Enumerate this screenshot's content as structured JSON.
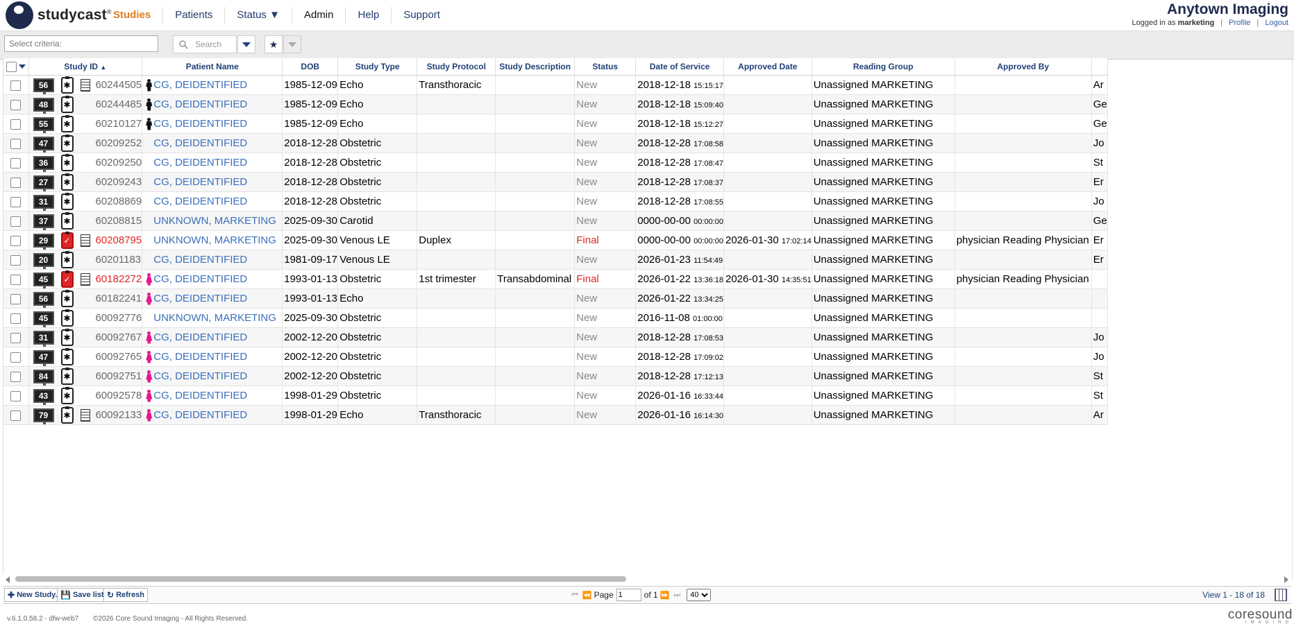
{
  "logo": {
    "wordmark": "studycast",
    "tm": "®"
  },
  "nav": [
    {
      "label": "Studies",
      "active": true
    },
    {
      "label": "Patients"
    },
    {
      "label": "Status ▼"
    },
    {
      "label": "Admin"
    },
    {
      "label": "Help"
    },
    {
      "label": "Support"
    }
  ],
  "brand": {
    "title": "Anytown Imaging",
    "logged_prefix": "Logged in as",
    "user": "marketing",
    "profile": "Profile",
    "logout": "Logout"
  },
  "toolbar": {
    "criteria_placeholder": "Select criteria:",
    "search_label": "Search"
  },
  "columns": [
    "Study ID",
    "Patient Name",
    "DOB",
    "Study Type",
    "Study Protocol",
    "Study Description",
    "Status",
    "Date of Service",
    "Approved Date",
    "Reading Group",
    "Approved By"
  ],
  "rows": [
    {
      "count": "56",
      "final": false,
      "doc": true,
      "id": "60244505",
      "gender": "m",
      "patient": "CG, DEIDENTIFIED",
      "dob": "1985-12-09",
      "type": "Echo",
      "protocol": "Transthoracic",
      "desc": "",
      "status": "New",
      "dos": "2018-12-18",
      "dos_t": "15:15:17",
      "appr": "",
      "appr_t": "",
      "group": "Unassigned MARKETING",
      "by": "",
      "extra": "Ar"
    },
    {
      "count": "48",
      "final": false,
      "doc": false,
      "id": "60244485",
      "gender": "m",
      "patient": "CG, DEIDENTIFIED",
      "dob": "1985-12-09",
      "type": "Echo",
      "protocol": "",
      "desc": "",
      "status": "New",
      "dos": "2018-12-18",
      "dos_t": "15:09:40",
      "appr": "",
      "appr_t": "",
      "group": "Unassigned MARKETING",
      "by": "",
      "extra": "Ge"
    },
    {
      "count": "55",
      "final": false,
      "doc": false,
      "id": "60210127",
      "gender": "m",
      "patient": "CG, DEIDENTIFIED",
      "dob": "1985-12-09",
      "type": "Echo",
      "protocol": "",
      "desc": "",
      "status": "New",
      "dos": "2018-12-18",
      "dos_t": "15:12:27",
      "appr": "",
      "appr_t": "",
      "group": "Unassigned MARKETING",
      "by": "",
      "extra": "Ge"
    },
    {
      "count": "47",
      "final": false,
      "doc": false,
      "id": "60209252",
      "gender": "n",
      "patient": "CG, DEIDENTIFIED",
      "dob": "2018-12-28",
      "type": "Obstetric",
      "protocol": "",
      "desc": "",
      "status": "New",
      "dos": "2018-12-28",
      "dos_t": "17:08:58",
      "appr": "",
      "appr_t": "",
      "group": "Unassigned MARKETING",
      "by": "",
      "extra": "Jo"
    },
    {
      "count": "36",
      "final": false,
      "doc": false,
      "id": "60209250",
      "gender": "n",
      "patient": "CG, DEIDENTIFIED",
      "dob": "2018-12-28",
      "type": "Obstetric",
      "protocol": "",
      "desc": "",
      "status": "New",
      "dos": "2018-12-28",
      "dos_t": "17:08:47",
      "appr": "",
      "appr_t": "",
      "group": "Unassigned MARKETING",
      "by": "",
      "extra": "St"
    },
    {
      "count": "27",
      "final": false,
      "doc": false,
      "id": "60209243",
      "gender": "n",
      "patient": "CG, DEIDENTIFIED",
      "dob": "2018-12-28",
      "type": "Obstetric",
      "protocol": "",
      "desc": "",
      "status": "New",
      "dos": "2018-12-28",
      "dos_t": "17:08:37",
      "appr": "",
      "appr_t": "",
      "group": "Unassigned MARKETING",
      "by": "",
      "extra": "Er"
    },
    {
      "count": "31",
      "final": false,
      "doc": false,
      "id": "60208869",
      "gender": "n",
      "patient": "CG, DEIDENTIFIED",
      "dob": "2018-12-28",
      "type": "Obstetric",
      "protocol": "",
      "desc": "",
      "status": "New",
      "dos": "2018-12-28",
      "dos_t": "17:08:55",
      "appr": "",
      "appr_t": "",
      "group": "Unassigned MARKETING",
      "by": "",
      "extra": "Jo"
    },
    {
      "count": "37",
      "final": false,
      "doc": false,
      "id": "60208815",
      "gender": "n",
      "patient": "UNKNOWN, MARKETING",
      "dob": "2025-09-30",
      "type": "Carotid",
      "protocol": "",
      "desc": "",
      "status": "New",
      "dos": "0000-00-00",
      "dos_t": "00:00:00",
      "appr": "",
      "appr_t": "",
      "group": "Unassigned MARKETING",
      "by": "",
      "extra": "Ge"
    },
    {
      "count": "29",
      "final": true,
      "doc": true,
      "id": "60208795",
      "gender": "n",
      "patient": "UNKNOWN, MARKETING",
      "dob": "2025-09-30",
      "type": "Venous LE",
      "protocol": "Duplex",
      "desc": "",
      "status": "Final",
      "dos": "0000-00-00",
      "dos_t": "00:00:00",
      "appr": "2026-01-30",
      "appr_t": "17:02:14",
      "group": "Unassigned MARKETING",
      "by": "physician Reading Physician",
      "extra": "Er"
    },
    {
      "count": "20",
      "final": false,
      "doc": false,
      "id": "60201183",
      "gender": "n",
      "patient": "CG, DEIDENTIFIED",
      "dob": "1981-09-17",
      "type": "Venous LE",
      "protocol": "",
      "desc": "",
      "status": "New",
      "dos": "2026-01-23",
      "dos_t": "11:54:49",
      "appr": "",
      "appr_t": "",
      "group": "Unassigned MARKETING",
      "by": "",
      "extra": "Er"
    },
    {
      "count": "45",
      "final": true,
      "doc": true,
      "id": "60182272",
      "gender": "f",
      "patient": "CG, DEIDENTIFIED",
      "dob": "1993-01-13",
      "type": "Obstetric",
      "protocol": "1st trimester",
      "desc": "Transabdominal",
      "status": "Final",
      "dos": "2026-01-22",
      "dos_t": "13:36:18",
      "appr": "2026-01-30",
      "appr_t": "14:35:51",
      "group": "Unassigned MARKETING",
      "by": "physician Reading Physician",
      "extra": ""
    },
    {
      "count": "56",
      "final": false,
      "doc": false,
      "id": "60182241",
      "gender": "f",
      "patient": "CG, DEIDENTIFIED",
      "dob": "1993-01-13",
      "type": "Echo",
      "protocol": "",
      "desc": "",
      "status": "New",
      "dos": "2026-01-22",
      "dos_t": "13:34:25",
      "appr": "",
      "appr_t": "",
      "group": "Unassigned MARKETING",
      "by": "",
      "extra": ""
    },
    {
      "count": "45",
      "final": false,
      "doc": false,
      "id": "60092776",
      "gender": "n",
      "patient": "UNKNOWN, MARKETING",
      "dob": "2025-09-30",
      "type": "Obstetric",
      "protocol": "",
      "desc": "",
      "status": "New",
      "dos": "2016-11-08",
      "dos_t": "01:00:00",
      "appr": "",
      "appr_t": "",
      "group": "Unassigned MARKETING",
      "by": "",
      "extra": ""
    },
    {
      "count": "31",
      "final": false,
      "doc": false,
      "id": "60092767",
      "gender": "f",
      "patient": "CG, DEIDENTIFIED",
      "dob": "2002-12-20",
      "type": "Obstetric",
      "protocol": "",
      "desc": "",
      "status": "New",
      "dos": "2018-12-28",
      "dos_t": "17:08:53",
      "appr": "",
      "appr_t": "",
      "group": "Unassigned MARKETING",
      "by": "",
      "extra": "Jo"
    },
    {
      "count": "47",
      "final": false,
      "doc": false,
      "id": "60092765",
      "gender": "f",
      "patient": "CG, DEIDENTIFIED",
      "dob": "2002-12-20",
      "type": "Obstetric",
      "protocol": "",
      "desc": "",
      "status": "New",
      "dos": "2018-12-28",
      "dos_t": "17:09:02",
      "appr": "",
      "appr_t": "",
      "group": "Unassigned MARKETING",
      "by": "",
      "extra": "Jo"
    },
    {
      "count": "84",
      "final": false,
      "doc": false,
      "id": "60092751",
      "gender": "f",
      "patient": "CG, DEIDENTIFIED",
      "dob": "2002-12-20",
      "type": "Obstetric",
      "protocol": "",
      "desc": "",
      "status": "New",
      "dos": "2018-12-28",
      "dos_t": "17:12:13",
      "appr": "",
      "appr_t": "",
      "group": "Unassigned MARKETING",
      "by": "",
      "extra": "St"
    },
    {
      "count": "43",
      "final": false,
      "doc": false,
      "id": "60092578",
      "gender": "f",
      "patient": "CG, DEIDENTIFIED",
      "dob": "1998-01-29",
      "type": "Obstetric",
      "protocol": "",
      "desc": "",
      "status": "New",
      "dos": "2026-01-16",
      "dos_t": "16:33:44",
      "appr": "",
      "appr_t": "",
      "group": "Unassigned MARKETING",
      "by": "",
      "extra": "St"
    },
    {
      "count": "79",
      "final": false,
      "doc": true,
      "id": "60092133",
      "gender": "f",
      "patient": "CG, DEIDENTIFIED",
      "dob": "1998-01-29",
      "type": "Echo",
      "protocol": "Transthoracic",
      "desc": "",
      "status": "New",
      "dos": "2026-01-16",
      "dos_t": "16:14:30",
      "appr": "",
      "appr_t": "",
      "group": "Unassigned MARKETING",
      "by": "",
      "extra": "Ar"
    }
  ],
  "bottom": {
    "new_study": "New Study...",
    "save_list": "Save list...",
    "refresh": "Refresh",
    "page_label": "Page",
    "page_value": "1",
    "of_label": "of 1",
    "page_size": "40",
    "view_info": "View 1 - 18 of 18"
  },
  "footer": {
    "version": "v.6.1.0.58.2 - dfw-web7",
    "copyright": "©2026 Core Sound Imaging - All Rights Reserved.",
    "logo_word": "coresound",
    "logo_sub": "IMAGING"
  },
  "colors": {
    "nav_active": "#e07b1f",
    "link": "#3b6fbb",
    "final": "#e02626",
    "header": "#1f3f77",
    "brand": "#1f2a4d"
  }
}
